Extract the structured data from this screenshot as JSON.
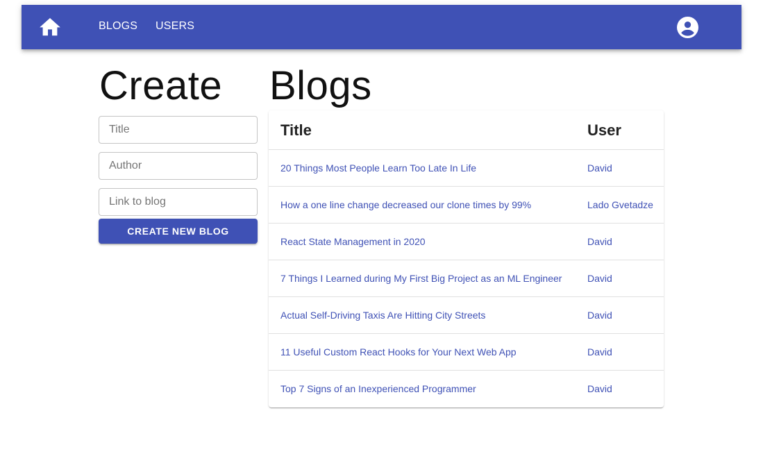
{
  "appbar": {
    "nav": [
      {
        "label": "BLOGS"
      },
      {
        "label": "USERS"
      }
    ],
    "color": "#3f51b5"
  },
  "create": {
    "heading": "Create",
    "fields": {
      "title_placeholder": "Title",
      "author_placeholder": "Author",
      "link_placeholder": "Link to blog"
    },
    "button_label": "CREATE NEW BLOG"
  },
  "blogs": {
    "heading": "Blogs",
    "columns": [
      "Title",
      "User"
    ],
    "rows": [
      {
        "title": "20 Things Most People Learn Too Late In Life",
        "user": "David"
      },
      {
        "title": "How a one line change decreased our clone times by 99%",
        "user": "Lado Gvetadze"
      },
      {
        "title": "React State Management in 2020",
        "user": "David"
      },
      {
        "title": "7 Things I Learned during My First Big Project as an ML Engineer",
        "user": "David"
      },
      {
        "title": "Actual Self-Driving Taxis Are Hitting City Streets",
        "user": "David"
      },
      {
        "title": "11 Useful Custom React Hooks for Your Next Web App",
        "user": "David"
      },
      {
        "title": "Top 7 Signs of an Inexperienced Programmer",
        "user": "David"
      }
    ]
  },
  "icons": {
    "home": "home-icon",
    "account": "account-circle-icon"
  }
}
